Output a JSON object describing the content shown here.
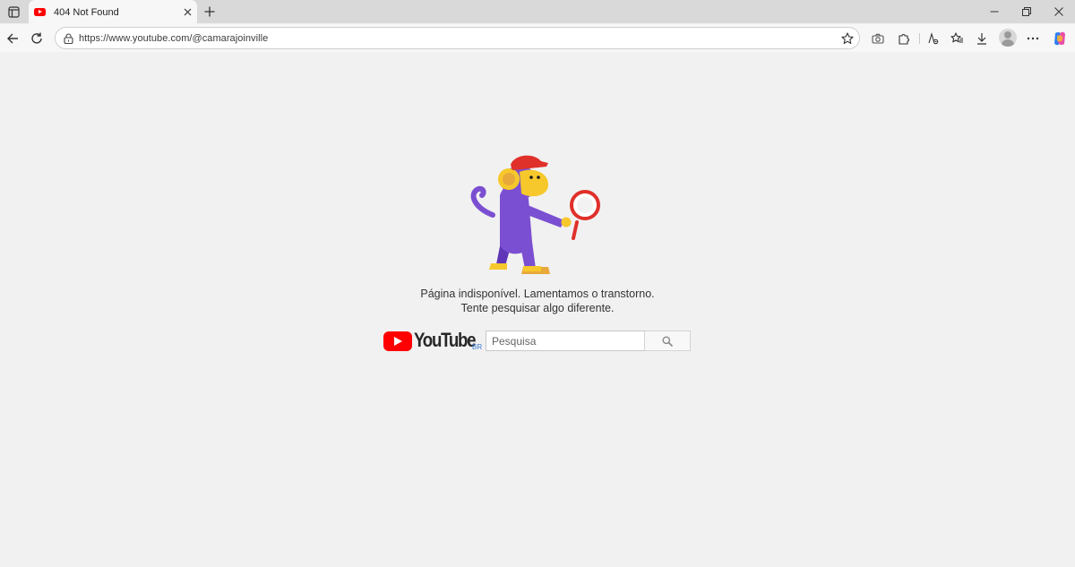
{
  "browser": {
    "tab_title": "404 Not Found",
    "url": "https://www.youtube.com/@camarajoinville",
    "icons": {
      "tab_actions": "tab-actions-icon",
      "close_tab": "close-icon",
      "new_tab": "plus-icon",
      "back": "back-arrow-icon",
      "reload": "reload-icon",
      "site_info": "lock-icon",
      "favorite": "star-icon",
      "screenshot": "camera-icon",
      "extensions": "puzzle-icon",
      "read_aloud": "read-aloud-icon",
      "favorites": "favorites-icon",
      "downloads": "download-icon",
      "profile": "avatar-icon",
      "more": "more-icon",
      "copilot": "copilot-icon",
      "minimize": "minimize-icon",
      "restore": "restore-icon",
      "close_window": "close-icon"
    }
  },
  "page": {
    "message_line1": "Página indisponível. Lamentamos o transtorno.",
    "message_line2": "Tente pesquisar algo diferente.",
    "logo_text": "YouTube",
    "logo_region": "BR",
    "search_placeholder": "Pesquisa",
    "colors": {
      "brand_red": "#ff0000",
      "background": "#f1f1f1",
      "monkey_purple": "#7b4fd1",
      "monkey_yellow": "#f6c82b"
    }
  }
}
